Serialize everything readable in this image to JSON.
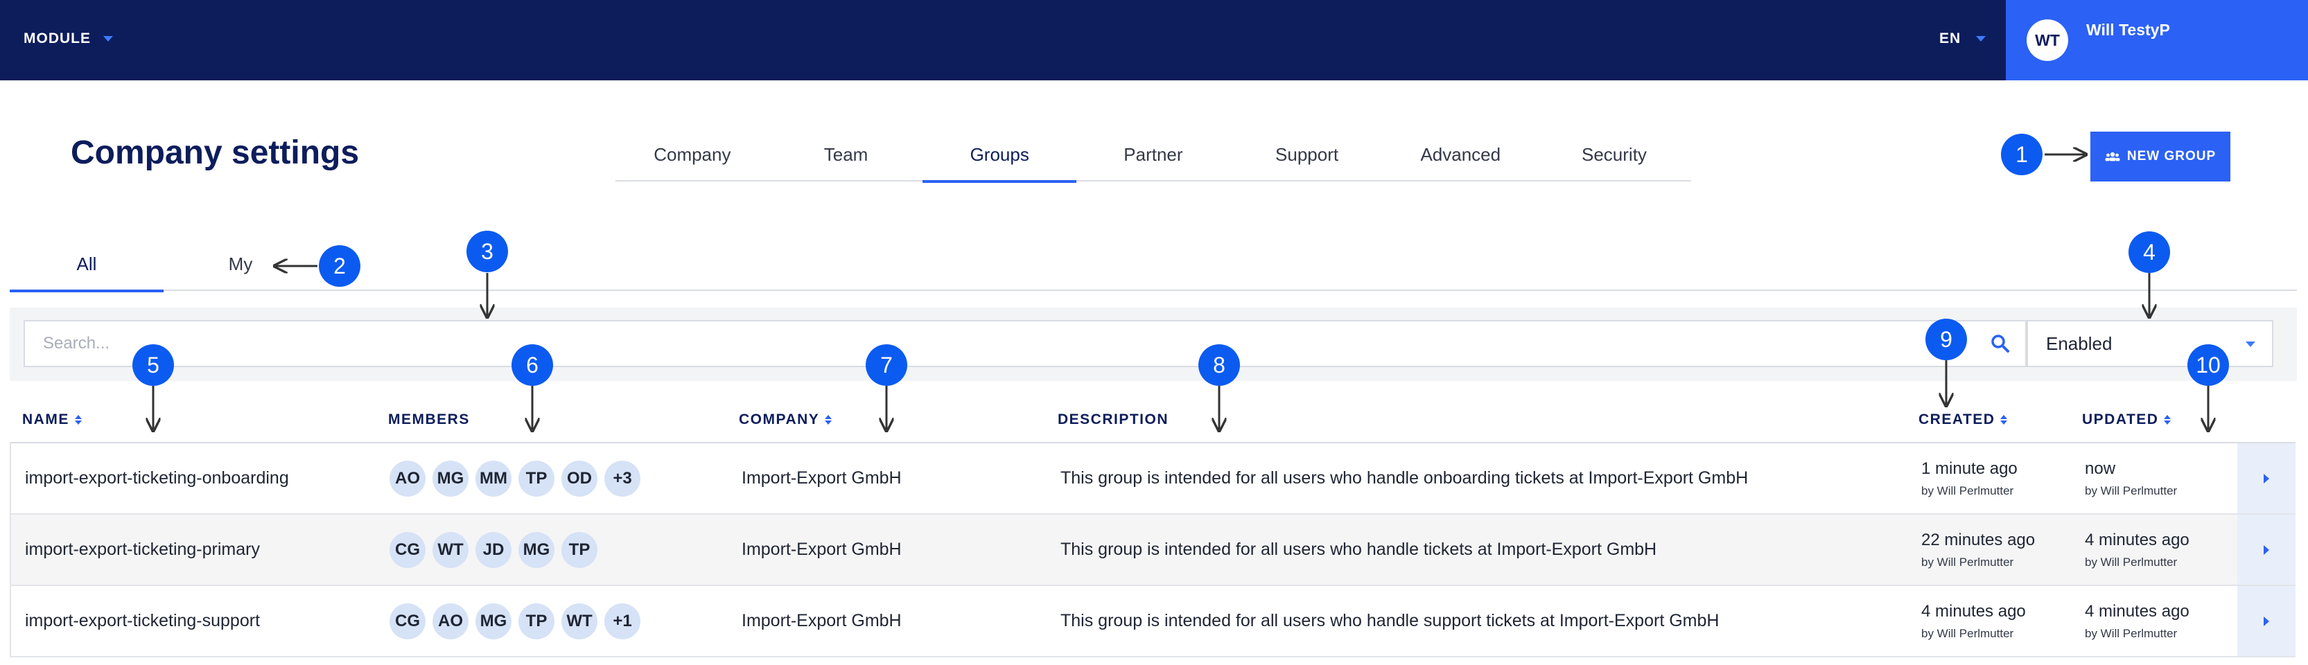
{
  "topbar": {
    "module_label": "MODULE",
    "language": "EN",
    "user_initials": "WT",
    "user_name": "Will TestyP"
  },
  "page_title": "Company settings",
  "main_tabs": [
    "Company",
    "Team",
    "Groups",
    "Partner",
    "Support",
    "Advanced",
    "Security"
  ],
  "active_main_tab": "Groups",
  "new_group_label": "NEW GROUP",
  "sub_tabs": [
    "All",
    "My"
  ],
  "active_sub_tab": "All",
  "search": {
    "placeholder": "Search...",
    "value": ""
  },
  "status_filter": {
    "selected": "Enabled"
  },
  "table": {
    "headers": {
      "name": "NAME",
      "members": "MEMBERS",
      "company": "COMPANY",
      "description": "DESCRIPTION",
      "created": "CREATED",
      "updated": "UPDATED"
    },
    "rows": [
      {
        "name": "import-export-ticketing-onboarding",
        "members": [
          "AO",
          "MG",
          "MM",
          "TP",
          "OD",
          "+3"
        ],
        "company": "Import-Export GmbH",
        "description": "This group is intended for all users who handle onboarding tickets at Import-Export GmbH",
        "created": "1 minute ago",
        "created_by": "by Will Perlmutter",
        "updated": "now",
        "updated_by": "by Will Perlmutter"
      },
      {
        "name": "import-export-ticketing-primary",
        "members": [
          "CG",
          "WT",
          "JD",
          "MG",
          "TP"
        ],
        "company": "Import-Export GmbH",
        "description": "This group is intended for all users who handle tickets at Import-Export GmbH",
        "created": "22 minutes ago",
        "created_by": "by Will Perlmutter",
        "updated": "4 minutes ago",
        "updated_by": "by Will Perlmutter"
      },
      {
        "name": "import-export-ticketing-support",
        "members": [
          "CG",
          "AO",
          "MG",
          "TP",
          "WT",
          "+1"
        ],
        "company": "Import-Export GmbH",
        "description": "This group is intended for all users who handle support tickets at Import-Export GmbH",
        "created": "4 minutes ago",
        "created_by": "by Will Perlmutter",
        "updated": "4 minutes ago",
        "updated_by": "by Will Perlmutter"
      }
    ]
  },
  "annotations": [
    "1",
    "2",
    "3",
    "4",
    "5",
    "6",
    "7",
    "8",
    "9",
    "10"
  ],
  "colors": {
    "navy": "#0d1d5c",
    "accent": "#2b61f5",
    "annotation": "#0c5bf0",
    "avatar_bg": "#d6e2f6"
  }
}
